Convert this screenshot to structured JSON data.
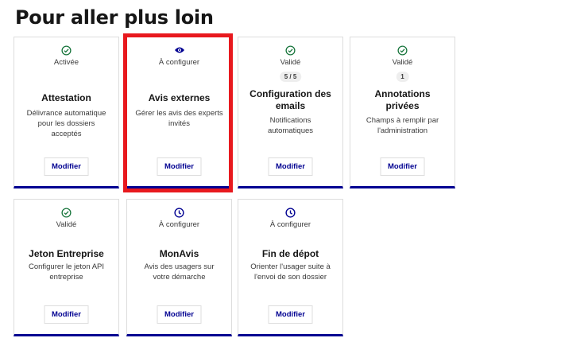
{
  "page": {
    "title": "Pour aller plus loin"
  },
  "colors": {
    "accent": "#000091",
    "success": "#18753c",
    "highlight": "#e8191e"
  },
  "cards": [
    {
      "icon": "check-circle-icon",
      "status": "Activée",
      "count": "",
      "title": "Attestation",
      "description": "Délivrance automatique pour les dossiers acceptés",
      "button": "Modifier"
    },
    {
      "icon": "eye-icon",
      "status": "À configurer",
      "count": "",
      "title": "Avis externes",
      "description": "Gérer les avis des experts invités",
      "button": "Modifier"
    },
    {
      "icon": "check-circle-icon",
      "status": "Validé",
      "count": "5 / 5",
      "title": "Configuration des emails",
      "description": "Notifications automatiques",
      "button": "Modifier"
    },
    {
      "icon": "check-circle-icon",
      "status": "Validé",
      "count": "1",
      "title": "Annotations privées",
      "description": "Champs à remplir par l'administration",
      "button": "Modifier"
    },
    {
      "icon": "check-circle-icon",
      "status": "Validé",
      "count": "",
      "title": "Jeton Entreprise",
      "description": "Configurer le jeton API entreprise",
      "button": "Modifier"
    },
    {
      "icon": "clock-icon",
      "status": "À configurer",
      "count": "",
      "title": "MonAvis",
      "description": "Avis des usagers sur votre démarche",
      "button": "Modifier"
    },
    {
      "icon": "clock-icon",
      "status": "À configurer",
      "count": "",
      "title": "Fin de dépot",
      "description": "Orienter l'usager suite à l'envoi de son dossier",
      "button": "Modifier"
    }
  ]
}
